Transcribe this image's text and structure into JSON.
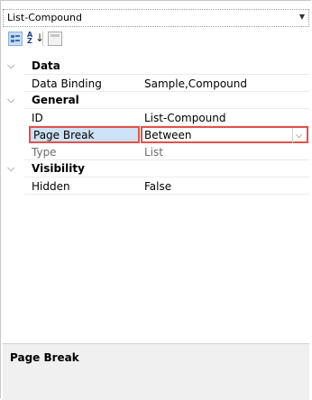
{
  "object_selector": {
    "value": "List-Compound",
    "arrow_icon": "dropdown-arrow-icon"
  },
  "toolbar": {
    "categorized_icon": "categorized-view-icon",
    "alphabetical_icon": "alphabetical-sort-icon",
    "alphabetical_glyph_top": "A",
    "alphabetical_glyph_bottom": "Z",
    "alphabetical_arrow": "↓",
    "property_pages_icon": "property-pages-icon"
  },
  "grid": {
    "categories": [
      {
        "label": "Data",
        "expanded": true,
        "properties": [
          {
            "name": "Data Binding",
            "value": "Sample,Compound",
            "readonly": false
          }
        ]
      },
      {
        "label": "General",
        "expanded": true,
        "properties": [
          {
            "name": "ID",
            "value": "List-Compound",
            "readonly": false
          },
          {
            "name": "Page Break",
            "value": "Between",
            "readonly": false,
            "selected": true
          },
          {
            "name": "Type",
            "value": "List",
            "readonly": true
          }
        ]
      },
      {
        "label": "Visibility",
        "expanded": true,
        "properties": [
          {
            "name": "Hidden",
            "value": "False",
            "readonly": false
          }
        ]
      }
    ]
  },
  "description": {
    "title": "Page Break"
  },
  "colors": {
    "selection_highlight": "#e0534a",
    "selected_name_bg": "#cde2f5"
  }
}
